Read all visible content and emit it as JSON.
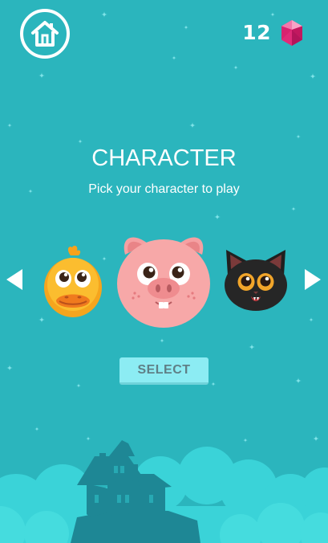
{
  "header": {
    "home_icon": "home-icon",
    "gem_count": "12",
    "gem_icon": "pink-gem-icon",
    "gem_color": "#e8317f"
  },
  "screen": {
    "title": "CHARACTER",
    "subtitle": "Pick your character to play"
  },
  "carousel": {
    "prev_icon": "arrow-left-icon",
    "next_icon": "arrow-right-icon",
    "characters": [
      {
        "name": "duck",
        "selected": false
      },
      {
        "name": "pig",
        "selected": true
      },
      {
        "name": "cat",
        "selected": false
      }
    ]
  },
  "select_button": {
    "label": "SELECT"
  },
  "colors": {
    "background": "#2bb5bd",
    "cloud": "#3ad3d8",
    "silhouette": "#1e8795",
    "button": "#8cecf3"
  }
}
